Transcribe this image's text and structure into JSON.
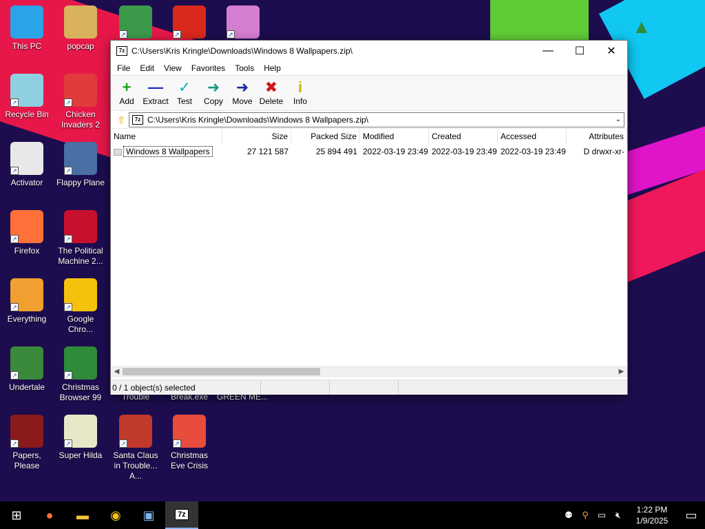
{
  "desktop_icons": [
    {
      "label": "This PC",
      "icon": "this-pc-icon",
      "color": "#2aa3e8"
    },
    {
      "label": "popcap",
      "icon": "folder-icon",
      "color": "#d9b25e"
    },
    {
      "label": "",
      "icon": "game-icon",
      "color": "#3a9a4a"
    },
    {
      "label": "",
      "icon": "mcdonalds-icon",
      "color": "#da291c"
    },
    {
      "label": "",
      "icon": "pig-icon",
      "color": "#d57fd0"
    },
    {
      "label": "Recycle Bin",
      "icon": "recycle-bin-icon",
      "color": "#8fd0e0"
    },
    {
      "label": "Chicken Invaders 2",
      "icon": "chicken-icon",
      "color": "#e23b3b"
    },
    {
      "label": "Activator",
      "icon": "file-icon",
      "color": "#e8e8e8"
    },
    {
      "label": "Flappy Plane",
      "icon": "flappy-icon",
      "color": "#4a6fa5"
    },
    {
      "label": "Firefox",
      "icon": "firefox-icon",
      "color": "#ff7139"
    },
    {
      "label": "The Political Machine 2...",
      "icon": "political-machine-icon",
      "color": "#c8102e"
    },
    {
      "label": "Everything",
      "icon": "search-icon",
      "color": "#f0a030"
    },
    {
      "label": "Google Chro...",
      "icon": "chrome-icon",
      "color": "#f4c20d"
    },
    {
      "label": "Undertale",
      "icon": "undertale-icon",
      "color": "#3b8a3b"
    },
    {
      "label": "Christmas Browser 99",
      "icon": "christmas-tree-icon",
      "color": "#2e8b3a"
    },
    {
      "label": "Papers, Please",
      "icon": "papers-please-icon",
      "color": "#8b1a1a"
    },
    {
      "label": "Super Hilda",
      "icon": "dog-icon",
      "color": "#e8e8c8"
    },
    {
      "label": "Santa Claus in Trouble... A...",
      "icon": "santa-icon",
      "color": "#c0392b"
    },
    {
      "label": "Christmas Eve Crisis",
      "icon": "santa-face-icon",
      "color": "#e74c3c"
    }
  ],
  "partial_labels": [
    "Trouble",
    "Break.exe",
    "GREEN ME..."
  ],
  "window": {
    "title": "C:\\Users\\Kris Kringle\\Downloads\\Windows 8 Wallpapers.zip\\",
    "app_icon_text": "7z",
    "minimize": "—",
    "maximize": "☐",
    "close": "✕",
    "menu": [
      "File",
      "Edit",
      "View",
      "Favorites",
      "Tools",
      "Help"
    ],
    "toolbar": [
      {
        "label": "Add",
        "icon": "plus-icon",
        "glyph": "+",
        "color": "#1aa31a"
      },
      {
        "label": "Extract",
        "icon": "minus-icon",
        "glyph": "—",
        "color": "#1a2fc7"
      },
      {
        "label": "Test",
        "icon": "check-icon",
        "glyph": "✓",
        "color": "#19b5b5"
      },
      {
        "label": "Copy",
        "icon": "copy-arrow-icon",
        "glyph": "➜",
        "color": "#1a9a8a"
      },
      {
        "label": "Move",
        "icon": "move-arrow-icon",
        "glyph": "➜",
        "color": "#1a2aa0"
      },
      {
        "label": "Delete",
        "icon": "delete-icon",
        "glyph": "✖",
        "color": "#d01818"
      },
      {
        "label": "Info",
        "icon": "info-icon",
        "glyph": "i",
        "color": "#c8b400"
      }
    ],
    "address": "C:\\Users\\Kris Kringle\\Downloads\\Windows 8 Wallpapers.zip\\",
    "columns": [
      "Name",
      "Size",
      "Packed Size",
      "Modified",
      "Created",
      "Accessed",
      "Attributes"
    ],
    "rows": [
      {
        "name": "Windows 8 Wallpapers",
        "size": "27 121 587",
        "packed": "25 894 491",
        "modified": "2022-03-19 23:49",
        "created": "2022-03-19 23:49",
        "accessed": "2022-03-19 23:49",
        "attributes": "D drwxr-xr-"
      }
    ],
    "status": "0 / 1 object(s) selected"
  },
  "taskbar": {
    "apps": [
      "windows-start-icon",
      "firefox-icon",
      "file-explorer-icon",
      "chrome-icon",
      "app-installer-icon",
      "7zip-icon"
    ],
    "time": "1:22 PM",
    "date": "1/9/2025"
  }
}
